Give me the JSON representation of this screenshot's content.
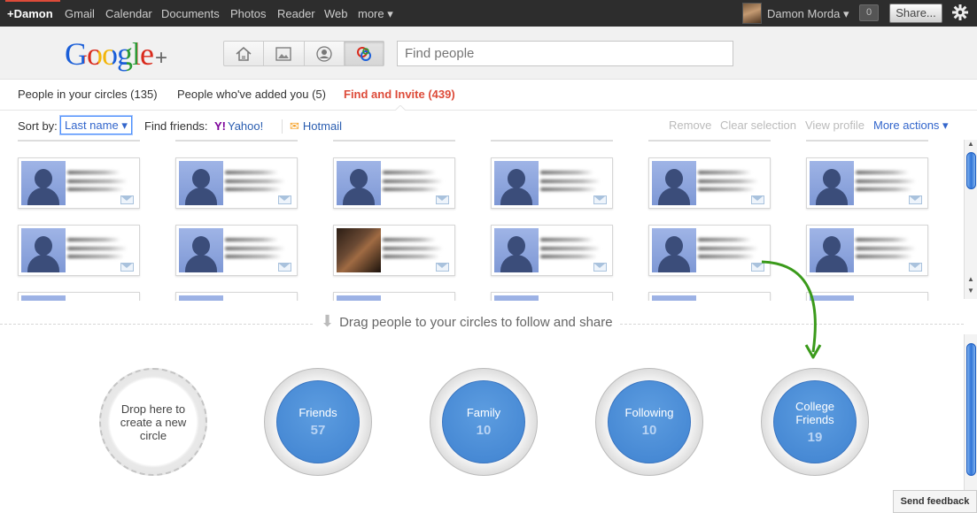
{
  "topbar": {
    "links": [
      "+Damon",
      "Gmail",
      "Calendar",
      "Documents",
      "Photos",
      "Reader",
      "Web",
      "more ▾"
    ],
    "user_name": "Damon Morda ▾",
    "notifications": "0",
    "share_label": "Share...",
    "gear_icon": "gear-icon"
  },
  "header": {
    "logo": "Google",
    "logo_plus": "+",
    "nav_icons": [
      "home-icon",
      "photos-icon",
      "profile-icon",
      "circles-icon"
    ],
    "search_placeholder": "Find people"
  },
  "tabs": [
    {
      "label": "People in your circles (135)"
    },
    {
      "label": "People who've added you (5)"
    },
    {
      "label": "Find and Invite (439)",
      "active": true
    }
  ],
  "toolbar": {
    "sort_label": "Sort by:",
    "sort_value": "Last name ▾",
    "find_friends_label": "Find friends:",
    "yahoo_label": "Yahoo!",
    "hotmail_label": "Hotmail",
    "remove_label": "Remove",
    "clear_label": "Clear selection",
    "view_profile_label": "View profile",
    "more_actions_label": "More actions ▾"
  },
  "drag_hint": "Drag people to your circles to follow and share",
  "new_circle_label": "Drop here to create a new circle",
  "circles": [
    {
      "name": "Friends",
      "count": "57"
    },
    {
      "name": "Family",
      "count": "10"
    },
    {
      "name": "Following",
      "count": "10"
    },
    {
      "name": "College Friends",
      "count": "19"
    }
  ],
  "send_feedback": "Send feedback",
  "colors": {
    "accent_red": "#dd4b39",
    "link_blue": "#3366cc",
    "circle_blue": "#4a8ad6",
    "arrow_green": "#3a9a1a"
  }
}
